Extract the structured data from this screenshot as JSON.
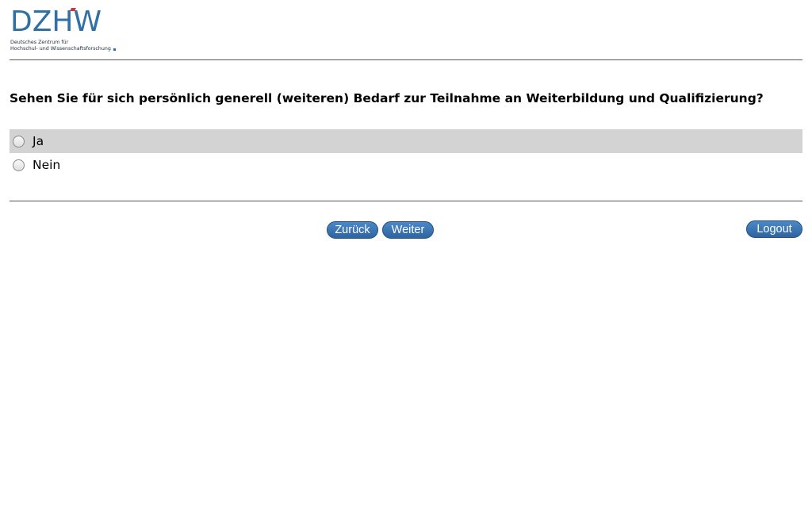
{
  "logo": {
    "mark": "DZHW",
    "subtitle_line1": "Deutsches Zentrum für",
    "subtitle_line2": "Hochschul- und Wissenschaftsforschung",
    "color": "#2f71a7"
  },
  "question": {
    "text": "Sehen Sie für sich persönlich generell (weiteren) Bedarf zur Teilnahme an Weiterbildung und Qualifizierung?"
  },
  "options": [
    {
      "label": "Ja",
      "selected": false,
      "highlighted": true
    },
    {
      "label": "Nein",
      "selected": false,
      "highlighted": false
    }
  ],
  "navigation": {
    "back_label": "Zurück",
    "next_label": "Weiter",
    "logout_label": "Logout",
    "button_color": "#3a74b4"
  }
}
